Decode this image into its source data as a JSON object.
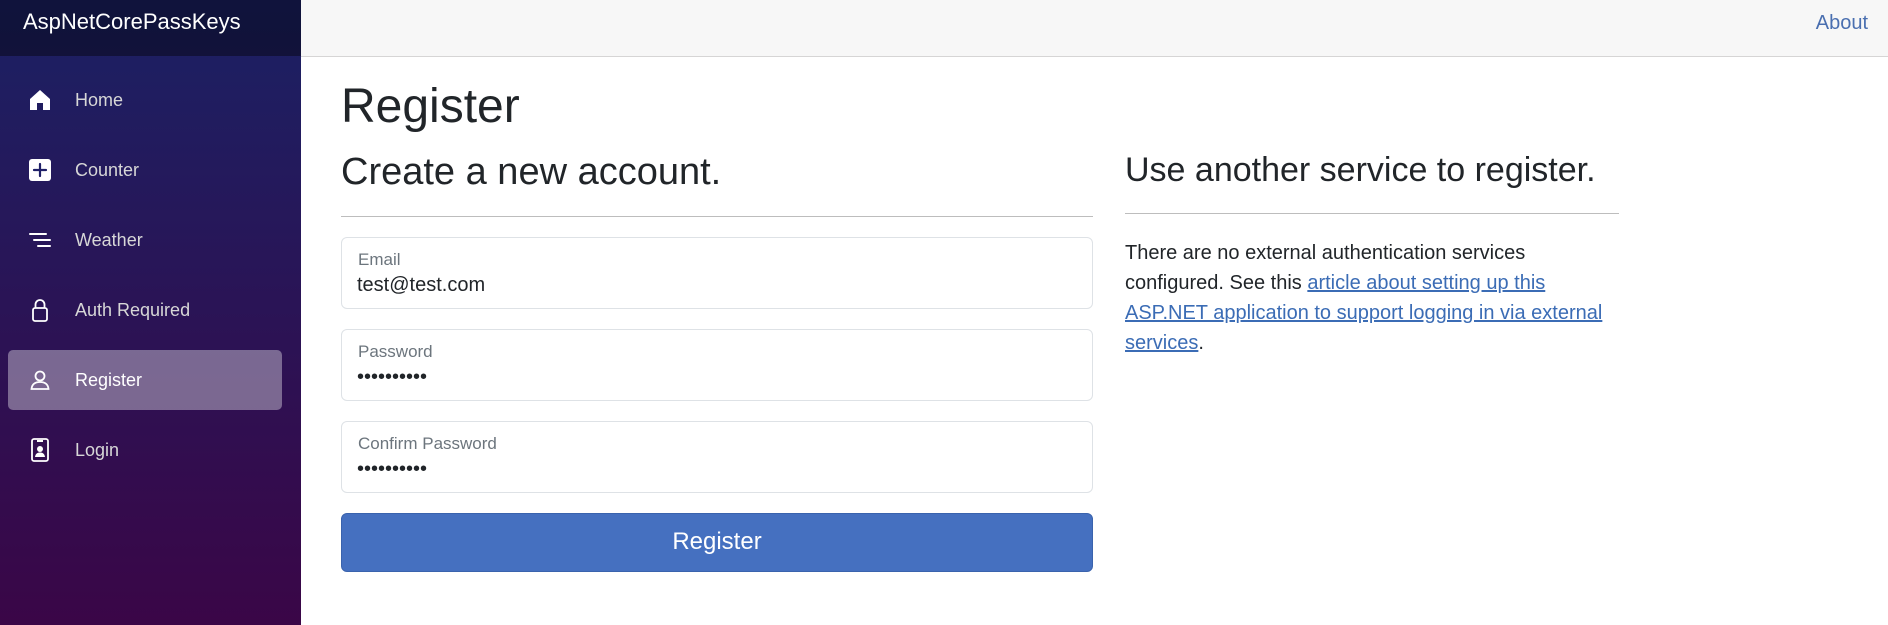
{
  "app": {
    "brand": "AspNetCorePassKeys"
  },
  "sidebar": {
    "items": [
      {
        "label": "Home",
        "icon": "home-icon",
        "active": false
      },
      {
        "label": "Counter",
        "icon": "plus-square-icon",
        "active": false
      },
      {
        "label": "Weather",
        "icon": "list-lines-icon",
        "active": false
      },
      {
        "label": "Auth Required",
        "icon": "lock-icon",
        "active": false
      },
      {
        "label": "Register",
        "icon": "person-icon",
        "active": true
      },
      {
        "label": "Login",
        "icon": "badge-icon",
        "active": false
      }
    ]
  },
  "top_row": {
    "about_label": "About"
  },
  "page": {
    "title": "Register"
  },
  "form": {
    "heading": "Create a new account.",
    "email": {
      "label": "Email",
      "value": "test@test.com"
    },
    "password": {
      "label": "Password",
      "value": "••••••••••"
    },
    "confirm_password": {
      "label": "Confirm Password",
      "value": "••••••••••"
    },
    "submit_label": "Register"
  },
  "external": {
    "heading": "Use another service to register.",
    "text_before": "There are no external authentication services configured. See this ",
    "link_text": "article about setting up this ASP.NET application to support logging in via external services",
    "text_after": "."
  },
  "colors": {
    "sidebar_top": "#1b2164",
    "sidebar_bottom": "#3a0647",
    "primary_button": "#4570c0",
    "link": "#3b6cb5"
  }
}
